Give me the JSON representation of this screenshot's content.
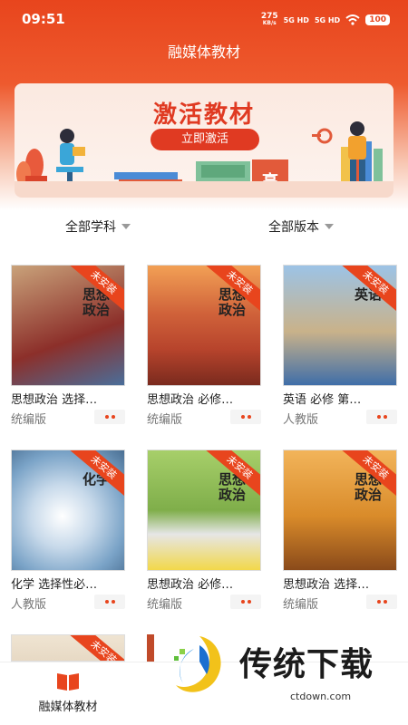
{
  "status_bar": {
    "time": "09:51",
    "net_speed_value": "275",
    "net_speed_unit": "KB/s",
    "sig1": "5G HD",
    "sig2": "5G HD",
    "battery": "100"
  },
  "header": {
    "title": "融媒体教材"
  },
  "banner": {
    "title": "激活教材",
    "button": "立即激活",
    "sign_char": "高"
  },
  "filters": [
    {
      "label": "全部学科"
    },
    {
      "label": "全部版本"
    }
  ],
  "books": [
    {
      "title": "思想政治 选择…",
      "version": "统编版",
      "badge": "未安装",
      "cover_title": "思想政治",
      "accent": "#8c2f2a"
    },
    {
      "title": "思想政治 必修…",
      "version": "统编版",
      "badge": "未安装",
      "cover_title": "思想政治",
      "accent": "#b7442c"
    },
    {
      "title": "英语 必修 第…",
      "version": "人教版",
      "badge": "未安装",
      "cover_title": "英语",
      "accent": "#3f6ea8"
    },
    {
      "title": "化学 选择性必…",
      "version": "人教版",
      "badge": "未安装",
      "cover_title": "化学",
      "accent": "#7aa3c7"
    },
    {
      "title": "思想政治 必修…",
      "version": "统编版",
      "badge": "未安装",
      "cover_title": "思想政治",
      "accent": "#7fae4a"
    },
    {
      "title": "思想政治 选择…",
      "version": "统编版",
      "badge": "未安装",
      "cover_title": "思想政治",
      "accent": "#d98b2a"
    },
    {
      "badge": "未安装",
      "accent": "#e7d9c4"
    },
    {
      "accent": "#c04a2a"
    }
  ],
  "tabbar": {
    "label": "融媒体教材"
  },
  "watermark": {
    "text": "传统下载",
    "url": "ctdown.com"
  }
}
